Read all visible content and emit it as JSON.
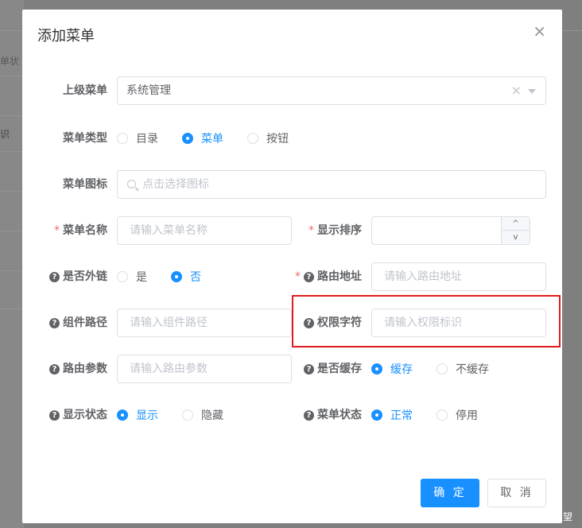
{
  "background": {
    "text_top": "单状",
    "text_col": "识"
  },
  "dialog": {
    "title": "添加菜单",
    "close_icon": "close-icon"
  },
  "form": {
    "parent_menu": {
      "label": "上级菜单",
      "value": "系统管理"
    },
    "menu_type": {
      "label": "菜单类型",
      "options": [
        "目录",
        "菜单",
        "按钮"
      ],
      "selected": "菜单"
    },
    "menu_icon": {
      "label": "菜单图标",
      "placeholder": "点击选择图标"
    },
    "menu_name": {
      "label": "菜单名称",
      "placeholder": "请输入菜单名称",
      "required": "*"
    },
    "order_num": {
      "label": "显示排序",
      "required": "*",
      "up": "^",
      "down": "v"
    },
    "is_frame": {
      "label": "是否外链",
      "options": [
        "是",
        "否"
      ],
      "selected": "否"
    },
    "path": {
      "label": "路由地址",
      "placeholder": "请输入路由地址",
      "required": "*"
    },
    "component": {
      "label": "组件路径",
      "placeholder": "请输入组件路径"
    },
    "perms": {
      "label": "权限字符",
      "placeholder": "请输入权限标识"
    },
    "query": {
      "label": "路由参数",
      "placeholder": "请输入路由参数"
    },
    "is_cache": {
      "label": "是否缓存",
      "options": [
        "缓存",
        "不缓存"
      ],
      "selected": "缓存"
    },
    "visible": {
      "label": "显示状态",
      "options": [
        "显示",
        "隐藏"
      ],
      "selected": "显示"
    },
    "status": {
      "label": "菜单状态",
      "options": [
        "正常",
        "停用"
      ],
      "selected": "正常"
    },
    "help_mark": "?"
  },
  "footer": {
    "confirm": "确 定",
    "cancel": "取 消"
  },
  "watermark": "CSDN @望 望",
  "colors": {
    "primary": "#1890ff",
    "required": "#f56c6c",
    "highlight": "#e01c1c"
  }
}
